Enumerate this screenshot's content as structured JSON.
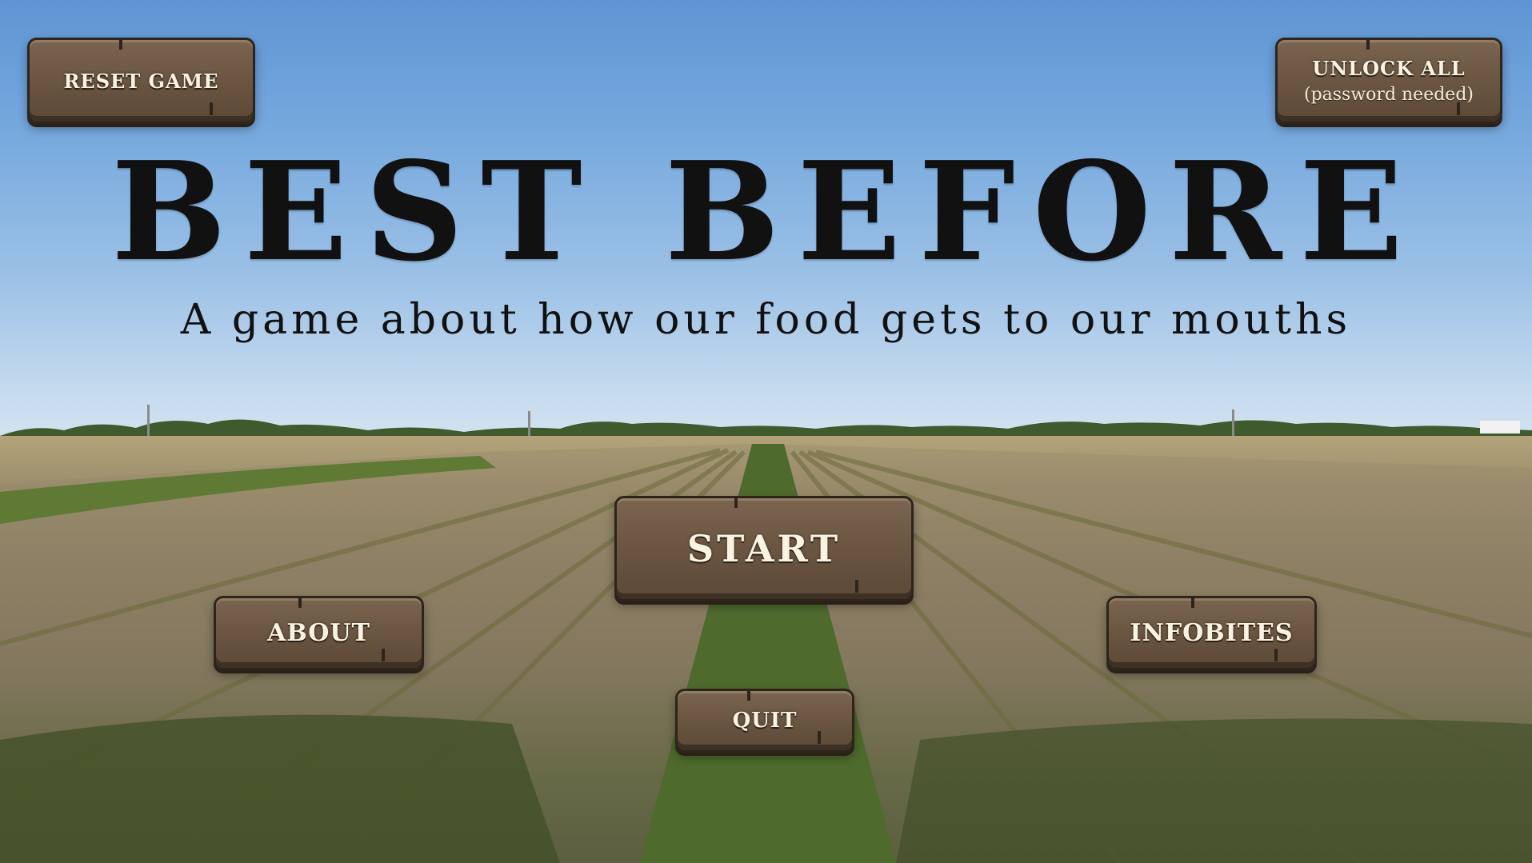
{
  "title": "BEST BEFORE",
  "subtitle": "A game about how our food gets to our mouths",
  "buttons": {
    "reset": "RESET GAME",
    "unlock": "UNLOCK ALL",
    "unlock_sub": "(password needed)",
    "start": "START",
    "about": "ABOUT",
    "infobites": "INFOBITES",
    "quit": "QUIT"
  },
  "colors": {
    "button_wood": "#6b5742",
    "button_border": "#2e241b",
    "button_text": "#fbf3e2",
    "title_text": "#111111",
    "sky": "#77a9de"
  },
  "background": "rice-paddy-field-photo"
}
